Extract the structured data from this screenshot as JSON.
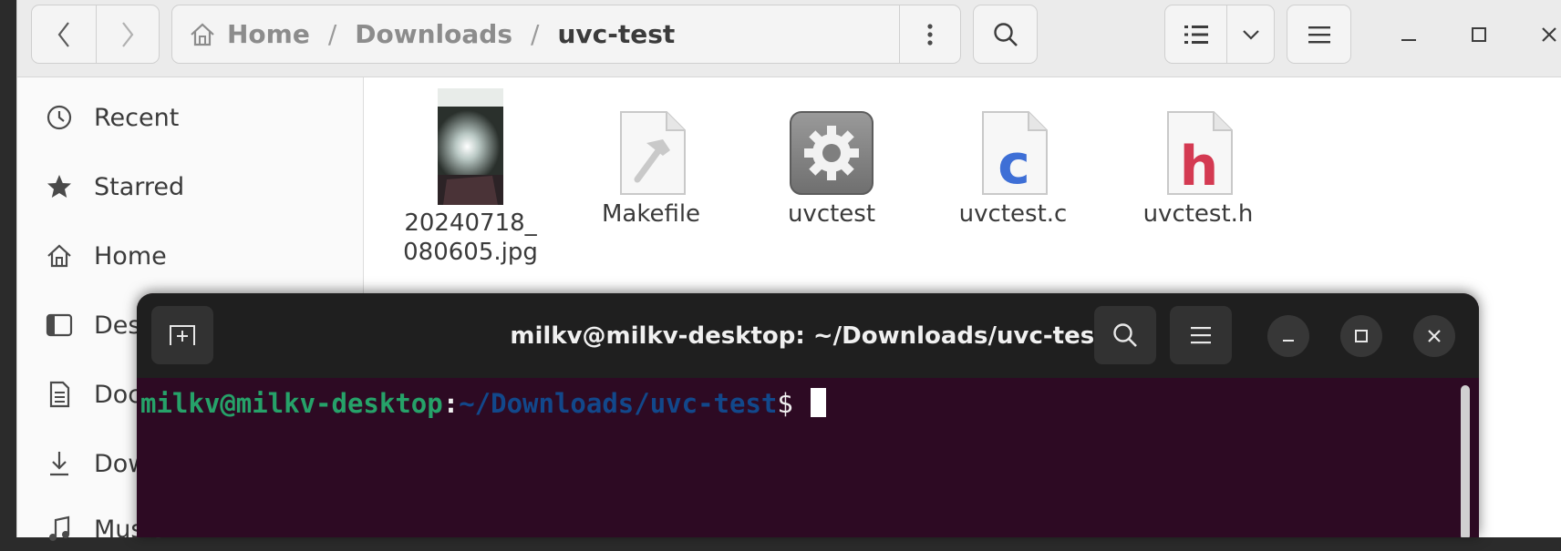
{
  "file_manager": {
    "breadcrumb": [
      "Home",
      "Downloads",
      "uvc-test"
    ],
    "breadcrumb_separator": "/",
    "sidebar": [
      {
        "label": "Recent",
        "icon": "clock-icon"
      },
      {
        "label": "Starred",
        "icon": "star-icon"
      },
      {
        "label": "Home",
        "icon": "home-icon"
      },
      {
        "label": "Desktop",
        "icon": "desktop-icon"
      },
      {
        "label": "Documents",
        "icon": "document-icon"
      },
      {
        "label": "Downloads",
        "icon": "download-icon"
      },
      {
        "label": "Music",
        "icon": "music-icon"
      }
    ],
    "files": [
      {
        "name_line1": "20240718_",
        "name_line2": "080605.jpg",
        "type": "image"
      },
      {
        "name_line1": "Makefile",
        "name_line2": "",
        "type": "makefile"
      },
      {
        "name_line1": "uvctest",
        "name_line2": "",
        "type": "executable"
      },
      {
        "name_line1": "uvctest.c",
        "name_line2": "",
        "type": "c-source",
        "glyph": "c"
      },
      {
        "name_line1": "uvctest.h",
        "name_line2": "",
        "type": "c-header",
        "glyph": "h"
      }
    ]
  },
  "terminal": {
    "title": "milkv@milkv-desktop: ~/Downloads/uvc-test",
    "prompt_user": "milkv@milkv-desktop",
    "prompt_colon": ":",
    "prompt_path": "~/Downloads/uvc-test",
    "prompt_symbol": "$ "
  },
  "colors": {
    "terminal_bg": "#2d0a23",
    "prompt_user": "#26a269",
    "prompt_path": "#12488b",
    "c_glyph": "#3e6fd6",
    "h_glyph": "#d43a52"
  }
}
